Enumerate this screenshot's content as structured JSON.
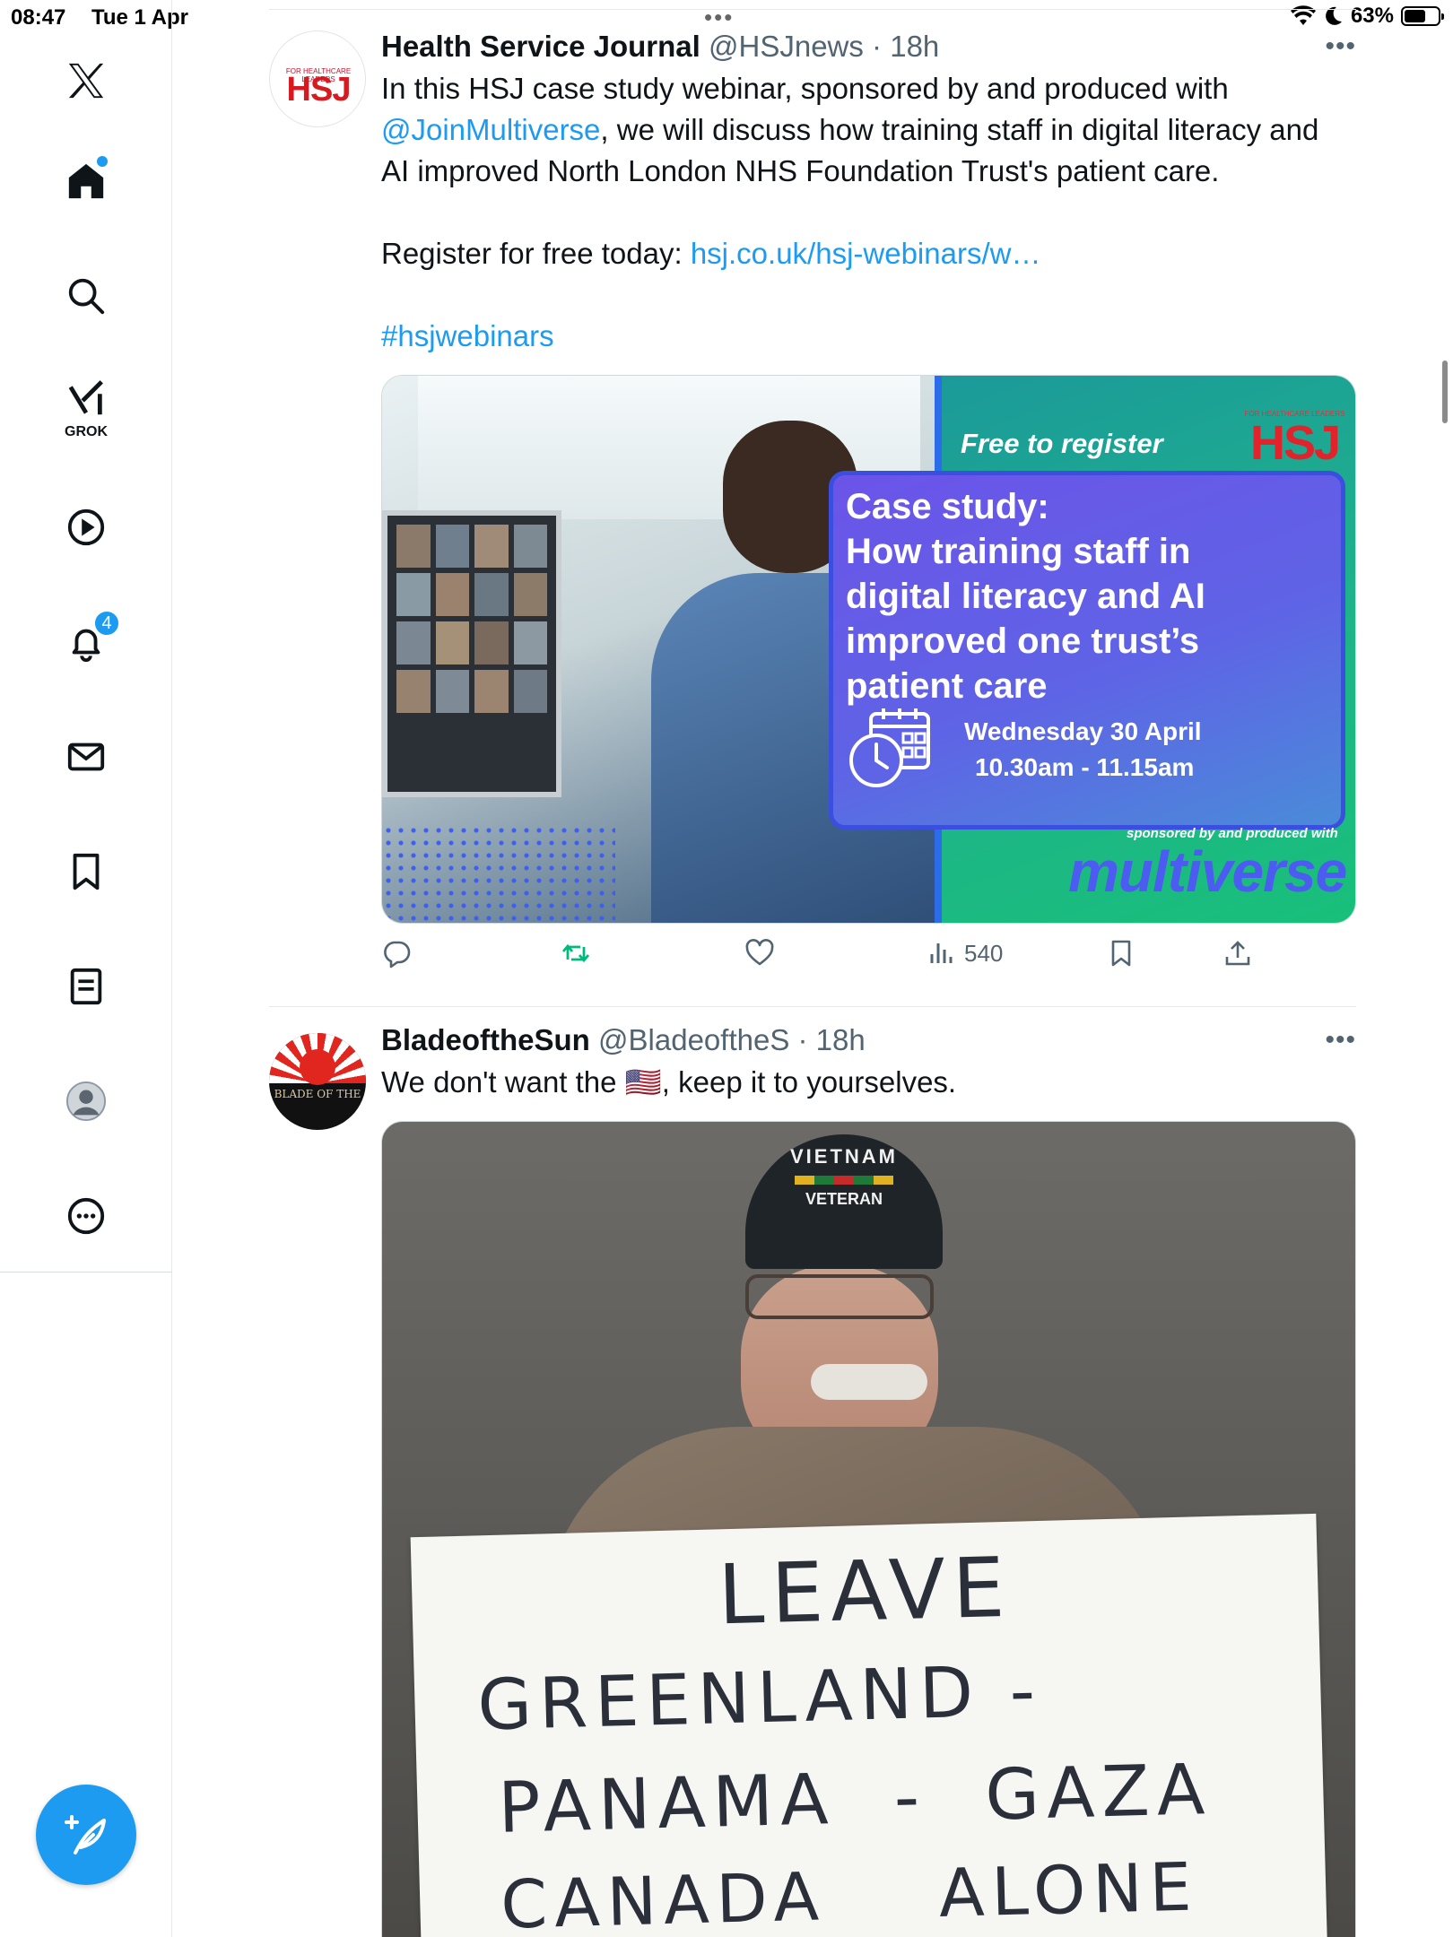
{
  "status_bar": {
    "time": "08:47",
    "date": "Tue 1 Apr",
    "battery": "63%",
    "battery_level": 0.63
  },
  "sidebar": {
    "items": [
      {
        "icon": "x-logo-icon"
      },
      {
        "icon": "home-icon",
        "has_dot": true
      },
      {
        "icon": "search-icon"
      },
      {
        "icon": "grok-icon",
        "label": "GROK"
      },
      {
        "icon": "video-play-icon"
      },
      {
        "icon": "notifications-bell-icon",
        "badge": "4"
      },
      {
        "icon": "messages-envelope-icon"
      },
      {
        "icon": "bookmark-icon"
      },
      {
        "icon": "lists-icon"
      },
      {
        "icon": "profile-avatar-icon"
      },
      {
        "icon": "more-options-icon"
      }
    ],
    "compose_icon": "compose-feather-icon"
  },
  "tweets": [
    {
      "name": "Health Service Journal",
      "handle": "@HSJnews",
      "time": "18h",
      "avatar_text": "HSJ",
      "avatar_small": "FOR HEALTHCARE LEADERS",
      "text_1": "In this HSJ case study webinar, sponsored by and produced with",
      "mention": "@JoinMultiverse",
      "text_2": ", we will discuss how training staff in digital literacy and",
      "text_3": "AI improved North London NHS Foundation Trust's patient care.",
      "register_text": "Register for free today: ",
      "register_link": "hsj.co.uk/hsj-webinars/w…",
      "hashtag": "#hsjwebinars",
      "card": {
        "free_to_register": "Free to register",
        "logo": "HSJ",
        "logo_small": "FOR HEALTHCARE LEADERS",
        "heading": "Case study:",
        "title_lines": [
          "How training staff in",
          "digital literacy and AI",
          "improved one trust’s",
          "patient care"
        ],
        "date": "Wednesday 30 April",
        "time": "10.30am - 11.15am",
        "sponsor_line": "sponsored by and produced with",
        "sponsor": "multiverse"
      },
      "views": "540"
    },
    {
      "name": "BladeoftheSun",
      "handle": "@BladeoftheS",
      "time": "18h",
      "avatar_text": "BLADE OF THE",
      "text_before": "We don't want the ",
      "flag": "🇺🇸",
      "text_after": ", keep it to yourselves.",
      "photo": {
        "cap_top": "VIETNAM",
        "cap_bottom": "VETERAN",
        "sign_lines": [
          "LEAVE",
          "GREENLAND -",
          "PANAMA  -  GAZA",
          "CANADA    ALONE"
        ]
      }
    }
  ]
}
